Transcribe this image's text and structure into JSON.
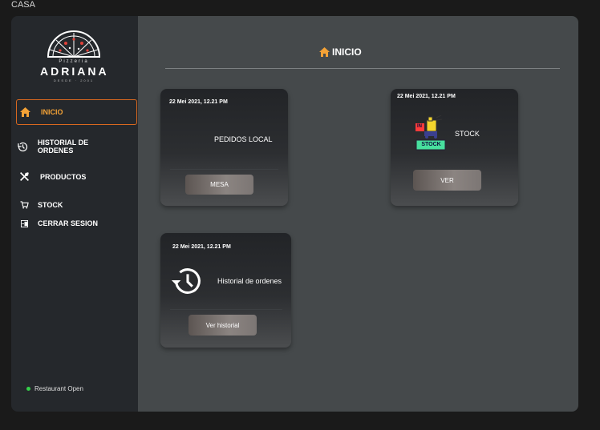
{
  "window": {
    "title": "CASA"
  },
  "brand": {
    "subtitle": "Pizzeria",
    "name": "ADRIANA",
    "tagline": "DESDE · 2001"
  },
  "sidebar": {
    "items": [
      {
        "label": "INICIO",
        "icon": "home-icon",
        "active": true
      },
      {
        "label": "HISTORIAL DE ORDENES",
        "icon": "history-icon"
      },
      {
        "label": "PRODUCTOS",
        "icon": "utensils-icon"
      },
      {
        "label": "STOCK",
        "icon": "cart-icon"
      },
      {
        "label": "CERRAR SESION",
        "icon": "logout-icon"
      }
    ],
    "status": "Restaurant Open"
  },
  "main": {
    "title": "INICIO"
  },
  "cards": {
    "pedidos": {
      "date": "22 Mei 2021, 12.21 PM",
      "label": "PEDIDOS LOCAL",
      "button": "MESA"
    },
    "stock": {
      "date": "22 Mei 2021, 12.21 PM",
      "label": "STOCK",
      "button": "VER",
      "image_text_top": "IN",
      "image_text_bottom": "STOCK"
    },
    "historial": {
      "date": "22 Mei 2021, 12.21 PM",
      "label": "Historial de ordenes",
      "button": "Ver historial"
    }
  },
  "colors": {
    "accent": "#f4a236",
    "active_border": "#d8681f",
    "status_dot": "#35d04a"
  }
}
